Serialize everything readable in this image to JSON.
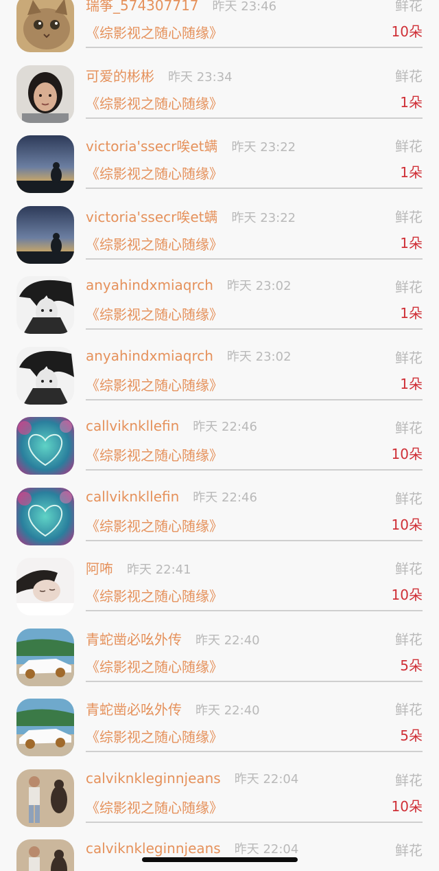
{
  "gift_list": {
    "items": [
      {
        "name": "瑞筝_574307717",
        "time": "昨天 23:46",
        "gift_label": "鲜花",
        "work": "《综影视之随心随缘》",
        "count": "10朵",
        "avatar_icon": "kitten-avatar"
      },
      {
        "name": "可爱的彬彬",
        "time": "昨天 23:34",
        "gift_label": "鲜花",
        "work": "《综影视之随心随缘》",
        "count": "1朵",
        "avatar_icon": "girl-portrait-avatar"
      },
      {
        "name": "victoria'ssecr唉et螨",
        "time": "昨天 23:22",
        "gift_label": "鲜花",
        "work": "《综影视之随心随缘》",
        "count": "1朵",
        "avatar_icon": "sunset-silhouette-avatar"
      },
      {
        "name": "victoria'ssecr唉et螨",
        "time": "昨天 23:22",
        "gift_label": "鲜花",
        "work": "《综影视之随心随缘》",
        "count": "1朵",
        "avatar_icon": "sunset-silhouette-avatar"
      },
      {
        "name": "anyahindxmiaqrch",
        "time": "昨天 23:02",
        "gift_label": "鲜花",
        "work": "《综影视之随心随缘》",
        "count": "1朵",
        "avatar_icon": "anime-boy-avatar"
      },
      {
        "name": "anyahindxmiaqrch",
        "time": "昨天 23:02",
        "gift_label": "鲜花",
        "work": "《综影视之随心随缘》",
        "count": "1朵",
        "avatar_icon": "anime-boy-avatar"
      },
      {
        "name": "callviknkllefin",
        "time": "昨天 22:46",
        "gift_label": "鲜花",
        "work": "《综影视之随心随缘》",
        "count": "10朵",
        "avatar_icon": "heart-bokeh-avatar"
      },
      {
        "name": "callviknkllefin",
        "time": "昨天 22:46",
        "gift_label": "鲜花",
        "work": "《综影视之随心随缘》",
        "count": "10朵",
        "avatar_icon": "heart-bokeh-avatar"
      },
      {
        "name": "阿咘",
        "time": "昨天 22:41",
        "gift_label": "鲜花",
        "work": "《综影视之随心随缘》",
        "count": "10朵",
        "avatar_icon": "sleeping-boy-avatar"
      },
      {
        "name": "青蛇凿必吆外传",
        "time": "昨天 22:40",
        "gift_label": "鲜花",
        "work": "《综影视之随心随缘》",
        "count": "5朵",
        "avatar_icon": "white-car-avatar"
      },
      {
        "name": "青蛇凿必吆外传",
        "time": "昨天 22:40",
        "gift_label": "鲜花",
        "work": "《综影视之随心随缘》",
        "count": "5朵",
        "avatar_icon": "white-car-avatar"
      },
      {
        "name": "calviknkleginnjeans",
        "time": "昨天 22:04",
        "gift_label": "鲜花",
        "work": "《综影视之随心随缘》",
        "count": "10朵",
        "avatar_icon": "man-with-dog-avatar"
      },
      {
        "name": "calviknkleginnjeans",
        "time": "昨天 22:04",
        "gift_label": "鲜花",
        "work": "",
        "count": "",
        "avatar_icon": "man-with-dog-avatar"
      }
    ]
  },
  "colors": {
    "name": "#e5915b",
    "time": "#b9b9b9",
    "count": "#cf2f36",
    "background": "#f8f8f8"
  }
}
